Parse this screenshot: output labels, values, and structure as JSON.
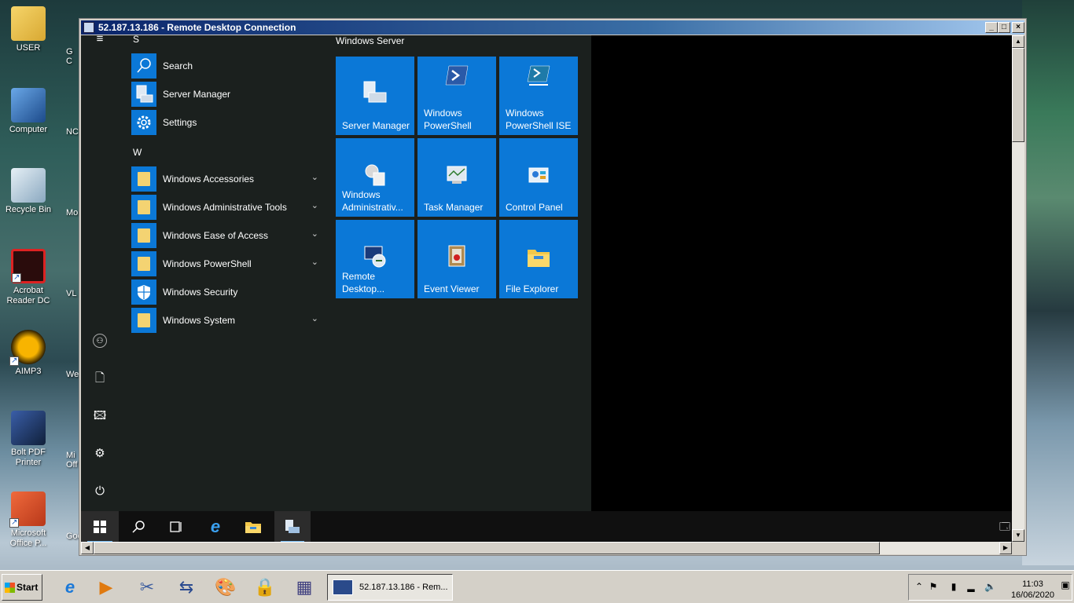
{
  "desktop": {
    "icons": [
      {
        "label": "USER",
        "icon": "user-folder-icon"
      },
      {
        "label": "Computer",
        "icon": "computer-icon"
      },
      {
        "label": "Recycle Bin",
        "icon": "recycle-bin-icon"
      },
      {
        "label": "Acrobat Reader DC",
        "icon": "acrobat-icon"
      },
      {
        "label": "AIMP3",
        "icon": "aimp-icon"
      },
      {
        "label": "Bolt PDF Printer",
        "icon": "bolt-pdf-icon"
      },
      {
        "label": "Microsoft Office P...",
        "icon": "powerpoint-icon"
      }
    ],
    "partial_labels": [
      "G",
      "C",
      "NC",
      "Mob",
      "VL",
      "Web",
      "Mi",
      "Off",
      "Goo"
    ]
  },
  "rdp_window": {
    "title": "52.187.13.186 - Remote Desktop Connection",
    "buttons": {
      "minimize": "_",
      "maximize": "□",
      "close": "×"
    }
  },
  "start_menu": {
    "letters": {
      "s": "S",
      "w": "W"
    },
    "apps_s": [
      {
        "label": "Search",
        "icon": "search-icon"
      },
      {
        "label": "Server Manager",
        "icon": "server-manager-icon"
      },
      {
        "label": "Settings",
        "icon": "gear-icon"
      }
    ],
    "apps_w": [
      {
        "label": "Windows Accessories",
        "icon": "folder-icon",
        "expand": "⌄"
      },
      {
        "label": "Windows Administrative Tools",
        "icon": "folder-icon",
        "expand": "⌄"
      },
      {
        "label": "Windows Ease of Access",
        "icon": "folder-icon",
        "expand": "⌄"
      },
      {
        "label": "Windows PowerShell",
        "icon": "folder-icon",
        "expand": "⌄"
      },
      {
        "label": "Windows Security",
        "icon": "shield-icon",
        "expand": ""
      },
      {
        "label": "Windows System",
        "icon": "folder-icon",
        "expand": "⌄"
      }
    ],
    "group_title": "Windows Server",
    "tiles": [
      {
        "label": "Server Manager",
        "icon": "server-manager-icon"
      },
      {
        "label": "Windows PowerShell",
        "icon": "powershell-icon"
      },
      {
        "label": "Windows PowerShell ISE",
        "icon": "powershell-ise-icon"
      },
      {
        "label": "Windows Administrativ...",
        "icon": "admin-tools-icon"
      },
      {
        "label": "Task Manager",
        "icon": "task-manager-icon"
      },
      {
        "label": "Control Panel",
        "icon": "control-panel-icon"
      },
      {
        "label": "Remote Desktop...",
        "icon": "remote-desktop-icon"
      },
      {
        "label": "Event Viewer",
        "icon": "event-viewer-icon"
      },
      {
        "label": "File Explorer",
        "icon": "file-explorer-icon"
      }
    ],
    "rail": [
      "hamburger-icon",
      "user-icon",
      "document-icon",
      "pictures-icon",
      "gear-icon",
      "power-icon"
    ]
  },
  "remote_taskbar": [
    "windows-start-icon",
    "search-icon",
    "task-view-icon",
    "internet-explorer-icon",
    "file-explorer-icon",
    "server-manager-icon"
  ],
  "host_taskbar": {
    "start_label": "Start",
    "task_item_label": "52.187.13.186 - Rem...",
    "clock_time": "11:03",
    "clock_date": "16/06/2020"
  },
  "colors": {
    "tile_blue": "#0b78d7",
    "start_bg": "#1b201e",
    "title_blue": "#0a246a"
  }
}
